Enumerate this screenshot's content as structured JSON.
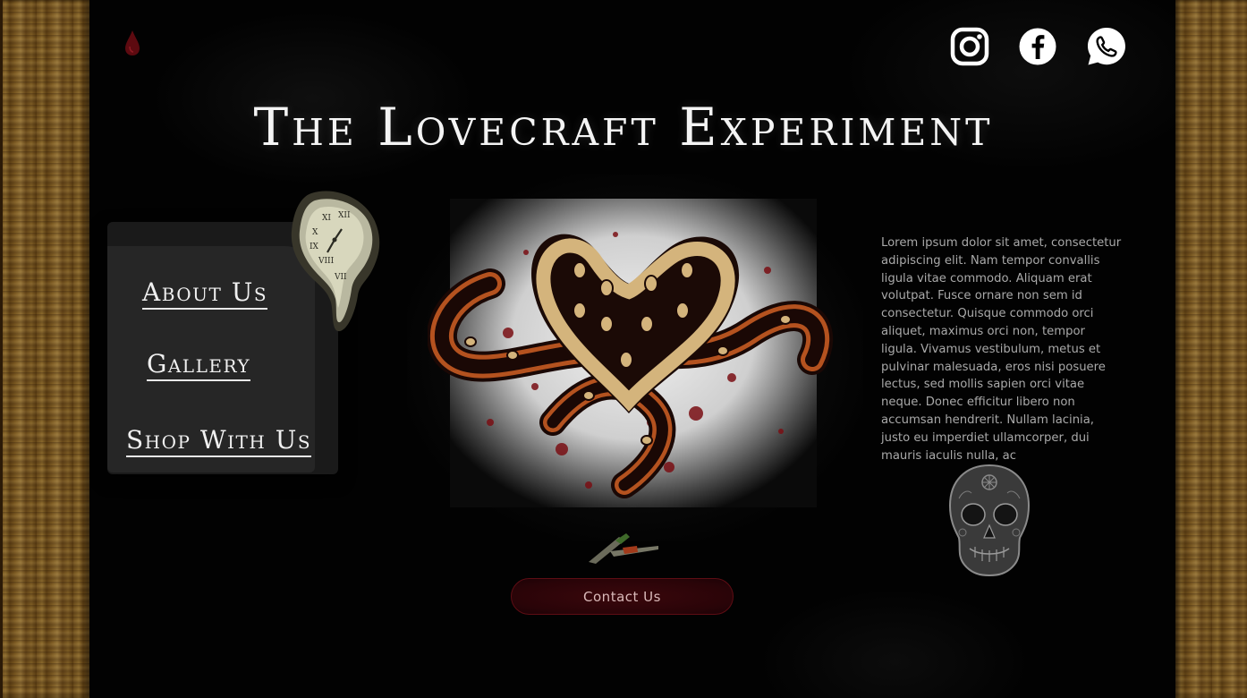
{
  "header": {
    "title": "The Lovecraft Experiment",
    "socials": [
      {
        "name": "Instagram",
        "icon": "instagram-icon"
      },
      {
        "name": "Facebook",
        "icon": "facebook-icon"
      },
      {
        "name": "WhatsApp",
        "icon": "whatsapp-icon"
      }
    ]
  },
  "nav": {
    "about_label": "About Us",
    "gallery_label": "Gallery",
    "shop_label": "Shop With Us"
  },
  "main": {
    "contact_label": "Contact Us"
  },
  "sidebar": {
    "text": "Lorem ipsum dolor sit amet, consectetur adipiscing elit. Nam tempor convallis ligula vitae commodo. Aliquam erat volutpat. Fusce ornare non sem id consectetur. Quisque commodo orci aliquet, maximus orci non, tempor ligula. Vivamus vestibulum, metus et pulvinar malesuada, eros nisi posuere lectus, sed mollis sapien orci vitae neque. Donec efficitur libero non accumsan hendrerit. Nullam lacinia, justo eu imperdiet ullamcorper, dui mauris iaculis nulla, ac"
  },
  "colors": {
    "background": "#000000",
    "accent_blood": "#7a0d15",
    "button_border": "#5e0d14",
    "wood": "#7b5a25",
    "text": "#a9a9a9"
  }
}
